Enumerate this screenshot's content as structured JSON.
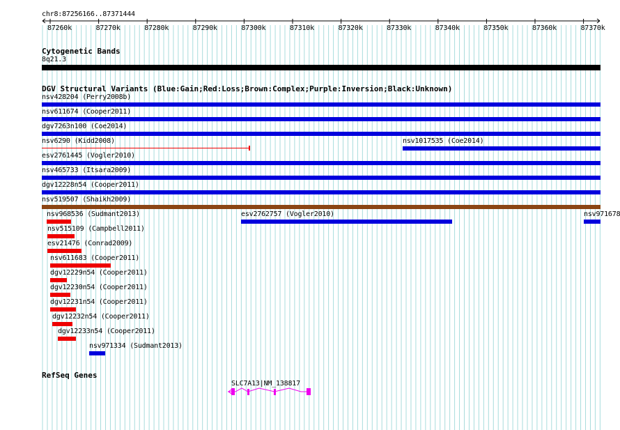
{
  "colors": {
    "gain": "#0000dd",
    "loss": "#ee0000",
    "complex": "#8b4513",
    "cytoband": "#000000",
    "gene": "#ee00ee",
    "grid": "#a8dcdc"
  },
  "ruler": {
    "label": "chr8:87256166..87371444",
    "ticks": [
      "87260k",
      "87270k",
      "87280k",
      "87290k",
      "87300k",
      "87310k",
      "87320k",
      "87330k",
      "87340k",
      "87350k",
      "87360k",
      "87370k"
    ]
  },
  "cytobands": {
    "title": "Cytogenetic Bands",
    "band_label": "8q21.3"
  },
  "dgv": {
    "title": "DGV Structural Variants (Blue:Gain;Red:Loss;Brown:Complex;Purple:Inversion;Black:Unknown)",
    "variants": [
      {
        "label": "nsv428204 (Perry2008b)",
        "type": "gain"
      },
      {
        "label": "nsv611674 (Cooper2011)",
        "type": "gain"
      },
      {
        "label": "dgv7263n100 (Coe2014)",
        "type": "gain"
      },
      {
        "label": "nsv6290 (Kidd2008)",
        "type": "loss"
      },
      {
        "label": "nsv1017535 (Coe2014)",
        "type": "gain"
      },
      {
        "label": "esv2761445 (Vogler2010)",
        "type": "gain"
      },
      {
        "label": "nsv465733 (Itsara2009)",
        "type": "gain"
      },
      {
        "label": "dgv12228n54 (Cooper2011)",
        "type": "gain"
      },
      {
        "label": "nsv519507 (Shaikh2009)",
        "type": "complex"
      },
      {
        "label": "nsv968536 (Sudmant2013)",
        "type": "loss"
      },
      {
        "label": "esv2762757 (Vogler2010)",
        "type": "gain"
      },
      {
        "label": "nsv971678",
        "type": "gain"
      },
      {
        "label": "nsv515109 (Campbell2011)",
        "type": "loss"
      },
      {
        "label": "esv21476 (Conrad2009)",
        "type": "loss"
      },
      {
        "label": "nsv611683 (Cooper2011)",
        "type": "loss"
      },
      {
        "label": "dgv12229n54 (Cooper2011)",
        "type": "loss"
      },
      {
        "label": "dgv12230n54 (Cooper2011)",
        "type": "loss"
      },
      {
        "label": "dgv12231n54 (Cooper2011)",
        "type": "loss"
      },
      {
        "label": "dgv12232n54 (Cooper2011)",
        "type": "loss"
      },
      {
        "label": "dgv12233n54 (Cooper2011)",
        "type": "loss"
      },
      {
        "label": "nsv971334 (Sudmant2013)",
        "type": "gain"
      }
    ]
  },
  "refseq": {
    "title": "RefSeq Genes",
    "gene_label": "SLC7A13|NM_138817",
    "strand": "minus"
  }
}
